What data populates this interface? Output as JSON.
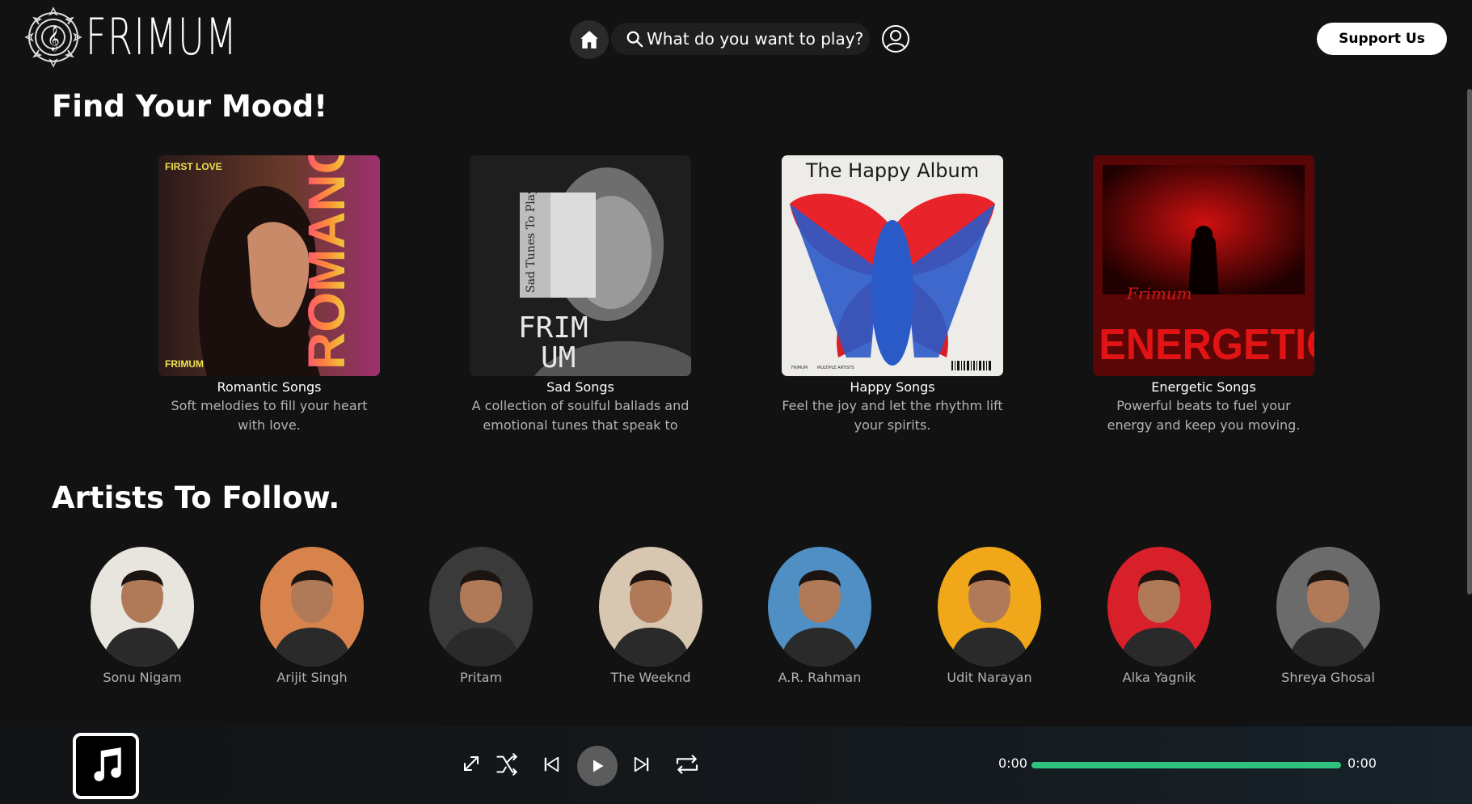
{
  "header": {
    "logo_text": "FRIMUM",
    "search_placeholder": "What do you want to play?",
    "support_label": "Support Us"
  },
  "moods": {
    "title": "Find Your Mood!",
    "cards": [
      {
        "name": "Romantic Songs",
        "desc": "Soft melodies to fill your heart with love.",
        "art_top": "FIRST LOVE",
        "art_big": "ROMANCE",
        "art_bottom": "FRIMUM"
      },
      {
        "name": "Sad Songs",
        "desc": "A collection of soulful ballads and emotional tunes that speak to yo...",
        "art_side": "Sad Tunes To Play",
        "art_big1": "FRIM",
        "art_big2": "UM"
      },
      {
        "name": "Happy Songs",
        "desc": "Feel the joy and let the rhythm lift your spirits.",
        "art_title": "The Happy Album",
        "art_small1": "FRIMUM",
        "art_small2": "MULTIPLE ARTISTS"
      },
      {
        "name": "Energetic Songs",
        "desc": "Powerful beats to fuel your energy and keep you moving.",
        "art_script": "Frimum",
        "art_big": "ENERGETIC"
      }
    ]
  },
  "artists": {
    "title": "Artists To Follow.",
    "items": [
      {
        "name": "Sonu Nigam",
        "bg": "#e8e4de"
      },
      {
        "name": "Arijit Singh",
        "bg": "#d9834c"
      },
      {
        "name": "Pritam",
        "bg": "#3a3a3a"
      },
      {
        "name": "The Weeknd",
        "bg": "#d8c7b0"
      },
      {
        "name": "A.R. Rahman",
        "bg": "#4f8fc4"
      },
      {
        "name": "Udit Narayan",
        "bg": "#f0a81a"
      },
      {
        "name": "Alka Yagnik",
        "bg": "#d8202a"
      },
      {
        "name": "Shreya Ghosal",
        "bg": "#6b6b6b"
      }
    ]
  },
  "player": {
    "current_time": "0:00",
    "duration": "0:00",
    "accent": "#2ec27e"
  }
}
